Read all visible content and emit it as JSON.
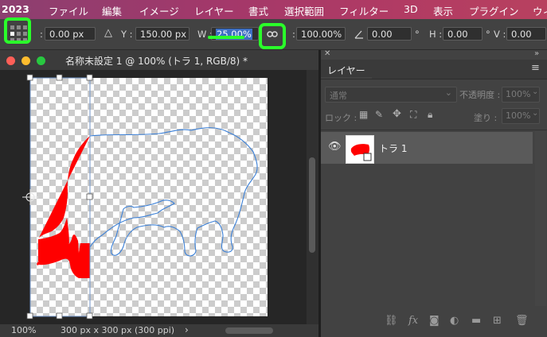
{
  "menubar": {
    "items": [
      "2023",
      "ファイル",
      "編集",
      "イメージ",
      "レイヤー",
      "書式",
      "選択範囲",
      "フィルター",
      "3D",
      "表示",
      "プラグイン",
      "ウィ"
    ]
  },
  "options": {
    "x_label": ":",
    "x_value": "0.00 px",
    "y_label": "Y :",
    "y_value": "150.00 px",
    "w_label": "W :",
    "w_value": "25.00%",
    "h_label": ":",
    "h_value": "100.00%",
    "angle_value": "0.00",
    "angle_unit": "°",
    "hskew_label": "H :",
    "hskew_value": "0.00",
    "hskew_unit": "°",
    "vskew_label": "V :",
    "vskew_value": "0.00"
  },
  "document": {
    "title": "名称未設定 1 @ 100% (トラ 1, RGB/8) *",
    "zoom": "100%",
    "doc_info": "300 px x 300 px (300 ppi)",
    "status_arrow": "›"
  },
  "layers_panel": {
    "tab_label": "レイヤー",
    "blend_mode": "通常",
    "opacity_label": "不透明度 :",
    "opacity_value": "100%",
    "lock_label": "ロック :",
    "fill_label": "塗り :",
    "fill_value": "100%",
    "layer_name": "トラ 1"
  },
  "colors": {
    "menubar": "#a3386a",
    "selection_blue": "#3e6fc2",
    "annotation_green": "#2aff2a",
    "tiger_fill": "#ff0000",
    "tiger_outline": "#3a7fd6"
  }
}
